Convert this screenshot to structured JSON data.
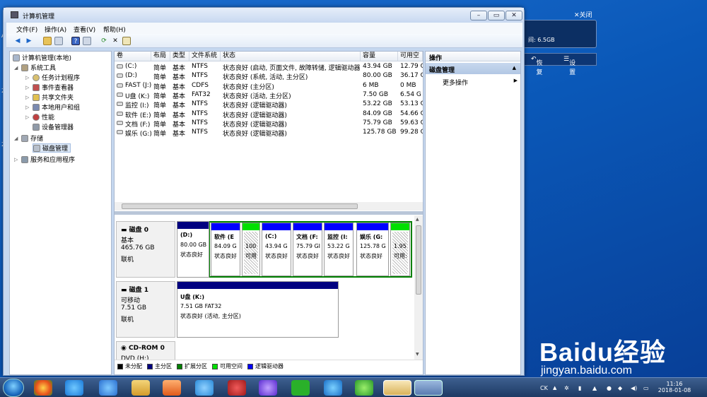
{
  "window": {
    "title": "计算机管理"
  },
  "menu": [
    "文件(F)",
    "操作(A)",
    "查看(V)",
    "帮助(H)"
  ],
  "tree": {
    "root": "计算机管理(本地)",
    "items": [
      {
        "label": "系统工具",
        "icon": "tools-icon",
        "level": 1
      },
      {
        "label": "任务计划程序",
        "icon": "clock-icon",
        "level": 2
      },
      {
        "label": "事件查看器",
        "icon": "event-icon",
        "level": 2
      },
      {
        "label": "共享文件夹",
        "icon": "folder-icon",
        "level": 2
      },
      {
        "label": "本地用户和组",
        "icon": "users-icon",
        "level": 2
      },
      {
        "label": "性能",
        "icon": "performance-icon",
        "level": 2
      },
      {
        "label": "设备管理器",
        "icon": "device-icon",
        "level": 2
      },
      {
        "label": "存储",
        "icon": "storage-icon",
        "level": 1
      },
      {
        "label": "磁盘管理",
        "icon": "disk-icon",
        "level": 2
      },
      {
        "label": "服务和应用程序",
        "icon": "services-icon",
        "level": 1
      }
    ]
  },
  "columns": [
    "卷",
    "布局",
    "类型",
    "文件系统",
    "状态",
    "容量",
    "可用空"
  ],
  "volumes": [
    {
      "vol": "(C:)",
      "layout": "简单",
      "type": "基本",
      "fs": "NTFS",
      "status": "状态良好 (启动, 页面文件, 故障转储, 逻辑驱动器)",
      "cap": "43.94 GB",
      "free": "12.79 G"
    },
    {
      "vol": "(D:)",
      "layout": "简单",
      "type": "基本",
      "fs": "NTFS",
      "status": "状态良好 (系统, 活动, 主分区)",
      "cap": "80.00 GB",
      "free": "36.17 G"
    },
    {
      "vol": "FAST (J:)",
      "layout": "简单",
      "type": "基本",
      "fs": "CDFS",
      "status": "状态良好 (主分区)",
      "cap": "6 MB",
      "free": "0 MB"
    },
    {
      "vol": "U盘 (K:)",
      "layout": "简单",
      "type": "基本",
      "fs": "FAT32",
      "status": "状态良好 (活动, 主分区)",
      "cap": "7.50 GB",
      "free": "6.54 G"
    },
    {
      "vol": "监控 (I:)",
      "layout": "简单",
      "type": "基本",
      "fs": "NTFS",
      "status": "状态良好 (逻辑驱动器)",
      "cap": "53.22 GB",
      "free": "53.13 G"
    },
    {
      "vol": "软件 (E:)",
      "layout": "简单",
      "type": "基本",
      "fs": "NTFS",
      "status": "状态良好 (逻辑驱动器)",
      "cap": "84.09 GB",
      "free": "54.66 G"
    },
    {
      "vol": "文档 (F:)",
      "layout": "简单",
      "type": "基本",
      "fs": "NTFS",
      "status": "状态良好 (逻辑驱动器)",
      "cap": "75.79 GB",
      "free": "59.63 G"
    },
    {
      "vol": "娱乐 (G:)",
      "layout": "简单",
      "type": "基本",
      "fs": "NTFS",
      "status": "状态良好 (逻辑驱动器)",
      "cap": "125.78 GB",
      "free": "99.28 G"
    }
  ],
  "disks": [
    {
      "name": "磁盘 0",
      "kind": "基本",
      "size": "465.76 GB",
      "state": "联机",
      "parts": [
        {
          "name": "(D:)",
          "size": "80.00 GB",
          "status": "状态良好",
          "color": "#000080"
        },
        {
          "name": "软件 (E",
          "size": "84.09 G",
          "status": "状态良好",
          "color": "#0000ff"
        },
        {
          "name": "",
          "size": "100",
          "status": "可用",
          "color": "#00e000"
        },
        {
          "name": "(C:)",
          "size": "43.94 G",
          "status": "状态良好",
          "color": "#0000ff"
        },
        {
          "name": "文档 (F:",
          "size": "75.79 GI",
          "status": "状态良好",
          "color": "#0000ff"
        },
        {
          "name": "监控 (I:",
          "size": "53.22 G",
          "status": "状态良好",
          "color": "#0000ff"
        },
        {
          "name": "娱乐 (G:",
          "size": "125.78 G",
          "status": "状态良好",
          "color": "#0000ff"
        },
        {
          "name": "",
          "size": "1.95",
          "status": "可用:",
          "color": "#00e000"
        }
      ]
    },
    {
      "name": "磁盘 1",
      "kind": "可移动",
      "size": "7.51 GB",
      "state": "联机",
      "parts": [
        {
          "name": "U盘 (K:)",
          "size": "7.51 GB FAT32",
          "status": "状态良好 (活动, 主分区)",
          "color": "#000080"
        }
      ]
    },
    {
      "name": "CD-ROM 0",
      "kind": "DVD (H:)",
      "size": "",
      "state": "",
      "parts": []
    }
  ],
  "legend": [
    {
      "label": "未分配",
      "color": "#000000"
    },
    {
      "label": "主分区",
      "color": "#000080"
    },
    {
      "label": "扩展分区",
      "color": "#008000"
    },
    {
      "label": "可用空间",
      "color": "#00e000"
    },
    {
      "label": "逻辑驱动器",
      "color": "#0000ff"
    }
  ],
  "actions": {
    "header": "操作",
    "section": "磁盘管理",
    "more": "更多操作"
  },
  "notification": {
    "close": "关闭",
    "text": "间: 6.5GB",
    "restore": "恢复",
    "settings": "设置"
  },
  "tray": {
    "lang": "CK",
    "time": "11:16",
    "date": "2018-01-08"
  },
  "watermark": {
    "brand": "Baidu经验",
    "url": "jingyan.baidu.com"
  }
}
